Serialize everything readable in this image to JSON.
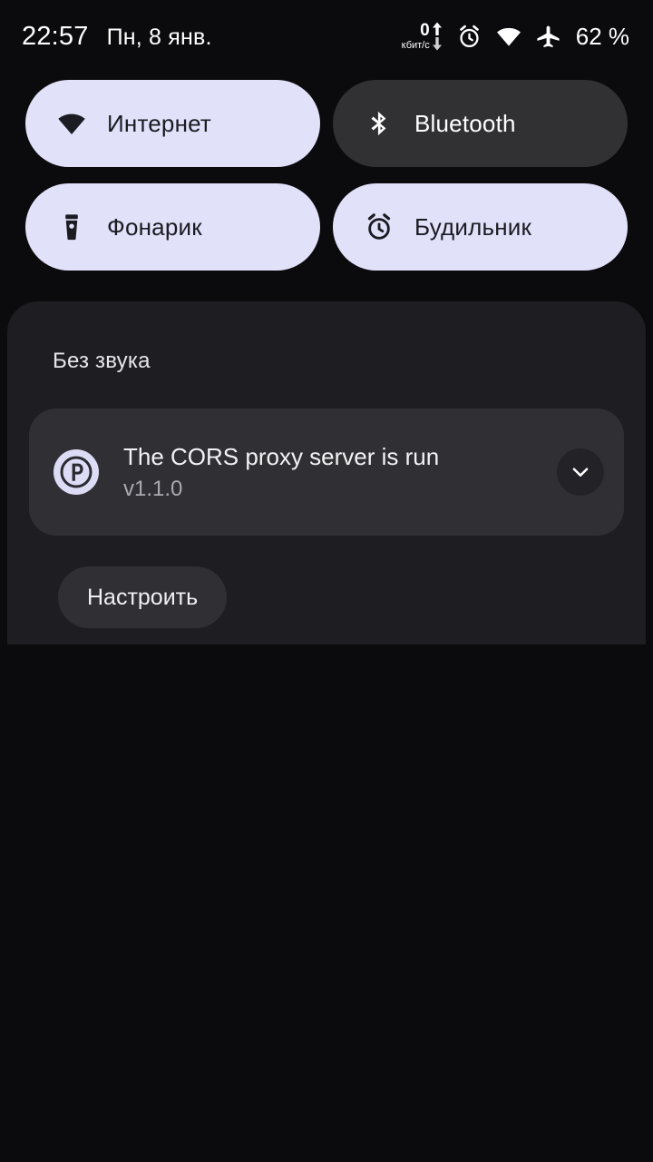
{
  "status_bar": {
    "clock": "22:57",
    "date": "Пн, 8 янв.",
    "network_speed": {
      "value": "0",
      "unit": "кбит/с",
      "up_arrow_icon": "arrow-up-icon",
      "down_arrow_icon": "arrow-down-icon"
    },
    "icons": [
      "alarm-clock-icon",
      "wifi-icon",
      "airplane-mode-icon"
    ],
    "battery": "62 %"
  },
  "quick_settings": {
    "tiles": [
      {
        "label": "Интернет",
        "icon": "wifi-icon",
        "state": "active"
      },
      {
        "label": "Bluetooth",
        "icon": "bluetooth-icon",
        "state": "inactive"
      },
      {
        "label": "Фонарик",
        "icon": "flashlight-icon",
        "state": "active"
      },
      {
        "label": "Будильник",
        "icon": "alarm-clock-icon",
        "state": "active"
      }
    ]
  },
  "notifications": {
    "section_title": "Без звука",
    "items": [
      {
        "app_icon": "proxy-p-icon",
        "title": "The CORS proxy server is run",
        "subtitle": "v1.1.0",
        "expand_icon": "chevron-down-icon"
      }
    ],
    "settings_button": "Настроить"
  },
  "colors": {
    "background": "#0b0b0d",
    "panel": "#1e1e22",
    "tile_active_bg": "#e1e1fa",
    "tile_active_fg": "#1b1b22",
    "tile_inactive_bg": "#313134",
    "tile_inactive_fg": "#ffffff",
    "card_bg": "#303034",
    "text_primary": "#f2f2f5",
    "text_secondary": "#a9a9b0"
  }
}
